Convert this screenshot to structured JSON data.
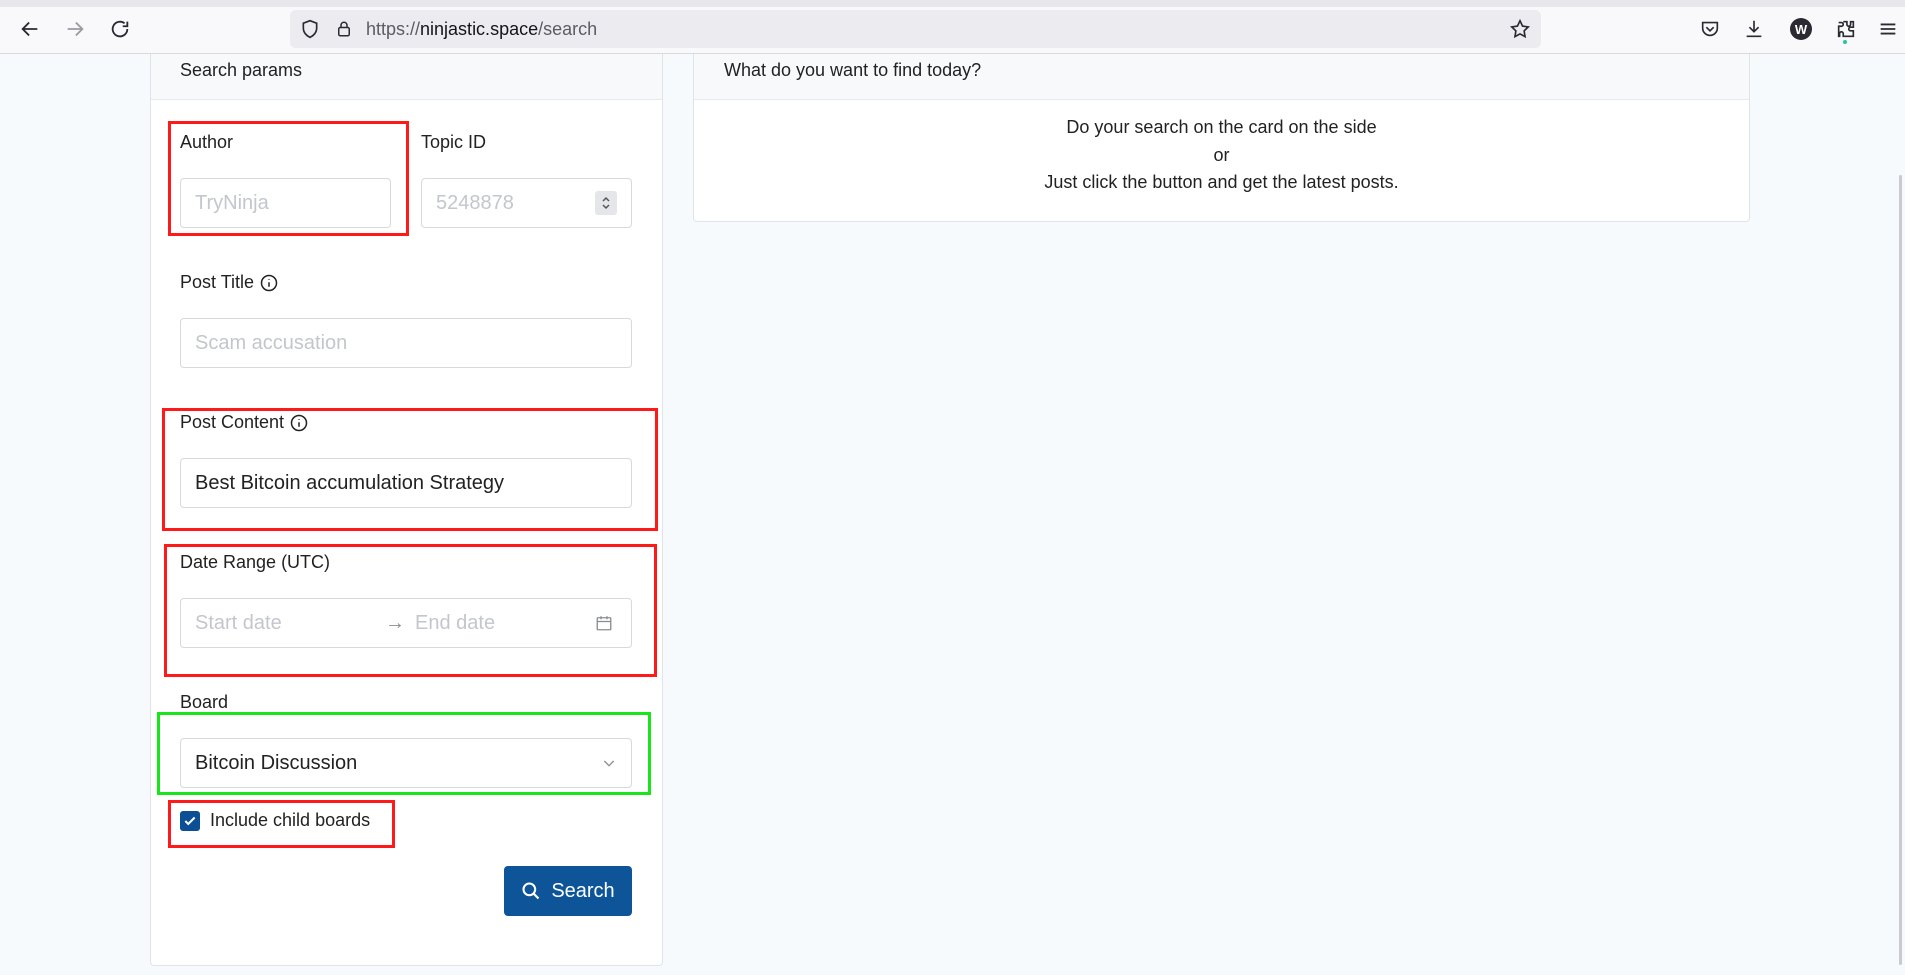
{
  "browser": {
    "url_prefix": "https://",
    "url_host": "ninjastic.space",
    "url_path": "/search",
    "profile_initial": "W"
  },
  "left_card": {
    "title": "Search params",
    "author": {
      "label": "Author",
      "placeholder": "TryNinja"
    },
    "topic_id": {
      "label": "Topic ID",
      "placeholder": "5248878"
    },
    "post_title": {
      "label": "Post Title",
      "placeholder": "Scam accusation"
    },
    "post_content": {
      "label": "Post Content",
      "value": "Best Bitcoin accumulation Strategy"
    },
    "date_range": {
      "label": "Date Range (UTC)",
      "start_placeholder": "Start date",
      "end_placeholder": "End date",
      "separator": "→"
    },
    "board": {
      "label": "Board",
      "value": "Bitcoin Discussion"
    },
    "include_child_boards": {
      "label": "Include child boards",
      "checked": true
    },
    "search_button": "Search"
  },
  "right_card": {
    "title": "What do you want to find today?",
    "line1": "Do your search on the card on the side",
    "line2": "or",
    "line3": "Just click the button and get the latest posts."
  },
  "annotation_colors": {
    "red": "#ff1a1a",
    "green": "#19e619"
  },
  "accent_color": "#0d5499"
}
